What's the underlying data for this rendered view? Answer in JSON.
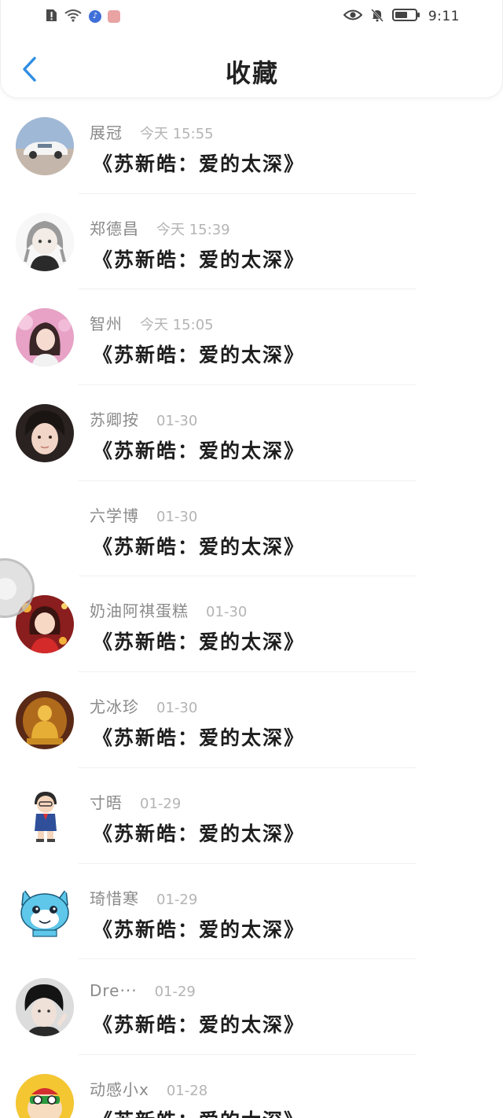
{
  "status_bar": {
    "time": "9:11",
    "icons_left": [
      "alert-sim-icon",
      "wifi-icon",
      "music-app-icon",
      "app-notification-icon"
    ],
    "icons_right": [
      "eye-comfort-icon",
      "mute-bell-icon",
      "battery-icon"
    ]
  },
  "header": {
    "title": "收藏",
    "back_icon": "chevron-left-icon",
    "accent_color": "#2f8de4"
  },
  "favorites": [
    {
      "name": "展冠",
      "time": "今天 15:55",
      "title": "《苏新皓：爱的太深》",
      "avatar": "car-avatar"
    },
    {
      "name": "郑德昌",
      "time": "今天 15:39",
      "title": "《苏新皓：爱的太深》",
      "avatar": "anime-girl-avatar"
    },
    {
      "name": "智州",
      "time": "今天 15:05",
      "title": "《苏新皓：爱的太深》",
      "avatar": "girl-pink-avatar"
    },
    {
      "name": "苏卿按",
      "time": "01-30",
      "title": "《苏新皓：爱的太深》",
      "avatar": "boy-portrait-avatar"
    },
    {
      "name": "六学博",
      "time": "01-30",
      "title": "《苏新皓：爱的太深》",
      "avatar": "empty-avatar"
    },
    {
      "name": "奶油阿祺蛋糕",
      "time": "01-30",
      "title": "《苏新皓：爱的太深》",
      "avatar": "cartoon-girl-red-avatar"
    },
    {
      "name": "尤冰珍",
      "time": "01-30",
      "title": "《苏新皓：爱的太深》",
      "avatar": "golden-buddha-avatar"
    },
    {
      "name": "寸晤",
      "time": "01-29",
      "title": "《苏新皓：爱的太深》",
      "avatar": "detective-cartoon-avatar"
    },
    {
      "name": "琦惜寒",
      "time": "01-29",
      "title": "《苏新皓：爱的太深》",
      "avatar": "blue-cat-avatar"
    },
    {
      "name": "Dre···",
      "time": "01-29",
      "title": "《苏新皓：爱的太深》",
      "avatar": "boy-dark-avatar"
    },
    {
      "name": "动感小x",
      "time": "01-28",
      "title": "《苏新皓：爱的太深》",
      "avatar": "cartoon-kid-yellow-avatar"
    }
  ]
}
